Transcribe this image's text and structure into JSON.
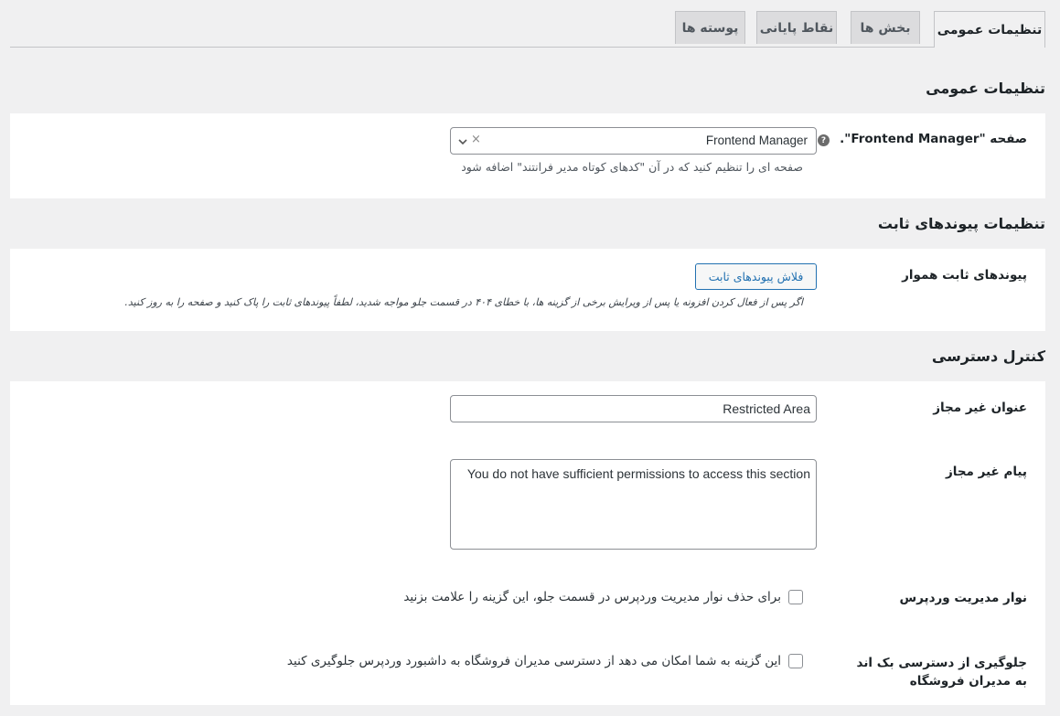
{
  "tabs": [
    {
      "label": "تنظیمات عمومی",
      "active": true
    },
    {
      "label": "بخش ها",
      "active": false
    },
    {
      "label": "نقاط پایانی",
      "active": false
    },
    {
      "label": "پوسته ها",
      "active": false
    }
  ],
  "general": {
    "title": "تنظیمات عمومی",
    "page_label": "صفحه \"Frontend Manager\".",
    "page_help": "?",
    "page_value": "Frontend Manager",
    "page_clear": "×",
    "page_desc": "صفحه ای را تنظیم کنید که در آن \"کدهای کوتاه مدیر فرانتند\" اضافه شود"
  },
  "permalinks": {
    "title": "تنظیمات پیوندهای ثابت",
    "label": "پیوندهای ثابت هموار",
    "button": "فلاش پیوندهای ثابت",
    "desc": "اگر پس از فعال کردن افزونه یا پس از ویرایش برخی از گزینه ها، با خطای ۴۰۴ در قسمت جلو مواجه شدید، لطفاً پیوندهای ثابت را پاک کنید و صفحه را به روز کنید."
  },
  "access": {
    "title": "کنترل دسترسی",
    "unauth_title_label": "عنوان غیر مجاز",
    "unauth_title_value": "Restricted Area",
    "unauth_msg_label": "پیام غیر مجاز",
    "unauth_msg_value": "You do not have sufficient permissions to access this section",
    "adminbar_label": "نوار مدیریت وردپرس",
    "adminbar_desc": "برای حذف نوار مدیریت وردپرس در قسمت جلو، این گزینه را علامت بزنید",
    "adminbar_checked": false,
    "backend_label": "جلوگیری از دسترسی بک اند به مدیران فروشگاه",
    "backend_desc": "این گزینه به شما امکان می دهد از دسترسی مدیران فروشگاه به داشبورد وردپرس جلوگیری کنید",
    "backend_checked": false
  }
}
